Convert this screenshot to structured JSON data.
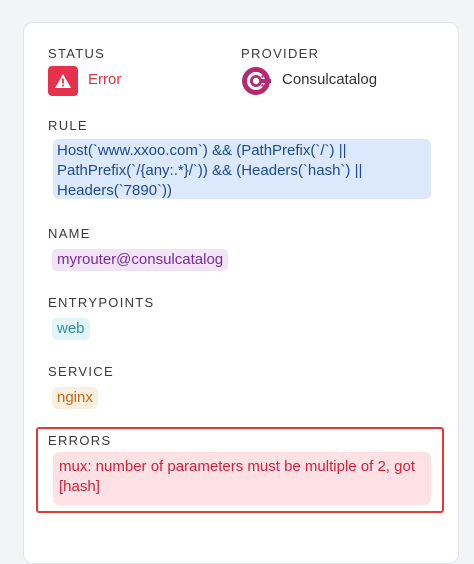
{
  "status": {
    "label": "STATUS",
    "value": "Error",
    "icon": "warning-triangle-icon",
    "color": "#e5314b"
  },
  "provider": {
    "label": "PROVIDER",
    "value": "Consulcatalog",
    "icon": "consul-icon",
    "color": "#b4296f"
  },
  "rule": {
    "label": "RULE",
    "value": "Host(`www.xxoo.com`) && (PathPrefix(`/`) ||\nPathPrefix(`/{any:.*}/`)) && (Headers(`hash`) ||\nHeaders(`7890`))"
  },
  "name": {
    "label": "NAME",
    "value": "myrouter@consulcatalog"
  },
  "entrypoints": {
    "label": "ENTRYPOINTS",
    "items": [
      "web"
    ]
  },
  "service": {
    "label": "SERVICE",
    "value": "nginx"
  },
  "errors": {
    "label": "ERRORS",
    "items": [
      "mux: number of parameters must be multiple of 2, got [hash]"
    ],
    "highlight_color": "#e53935"
  }
}
